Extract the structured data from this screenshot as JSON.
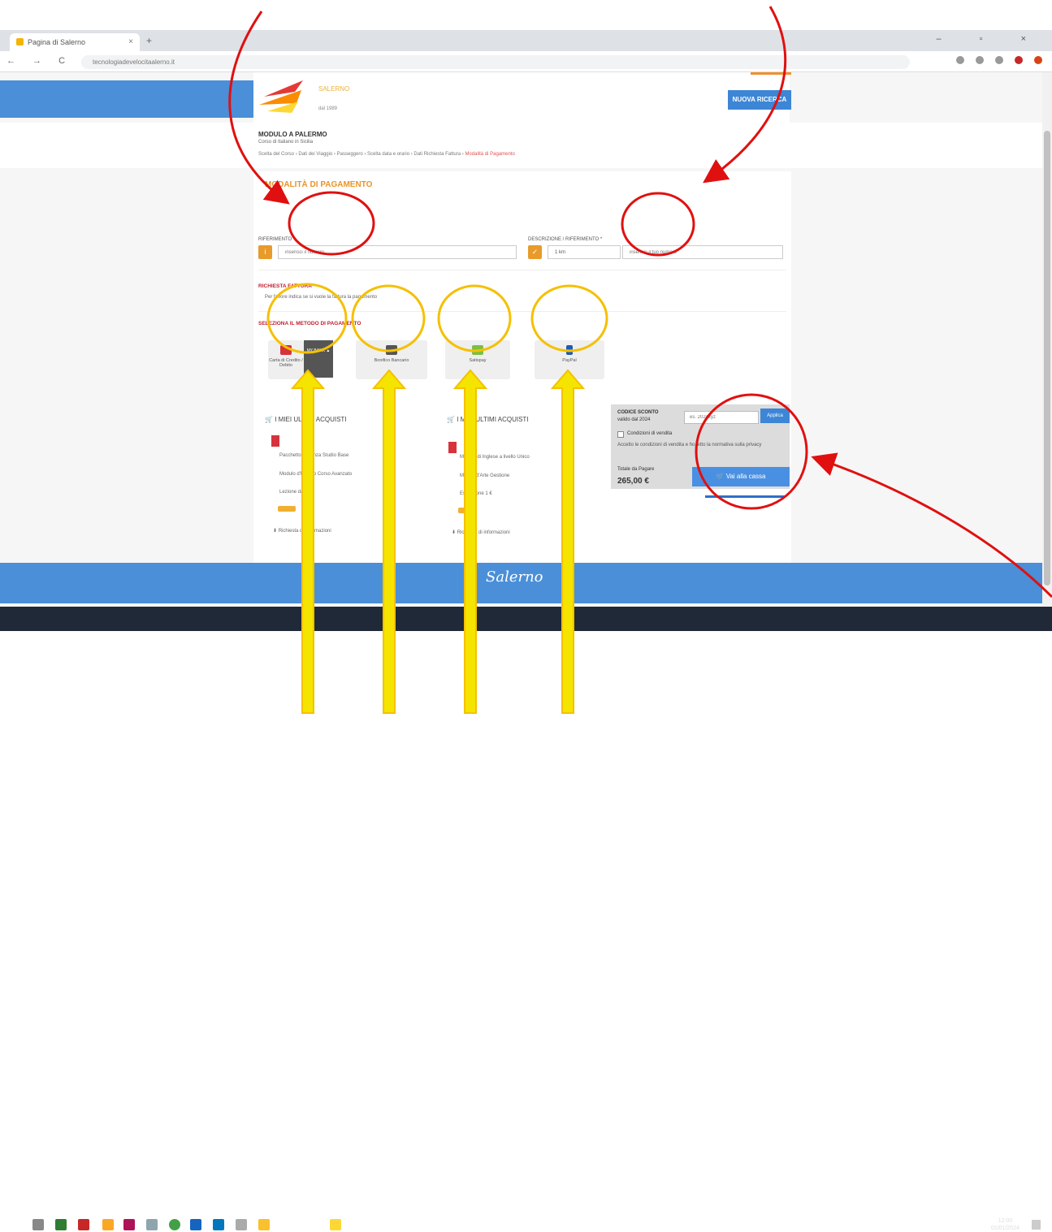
{
  "browser": {
    "tab_title": "Pagina di Salerno",
    "close_glyph": "×",
    "newtab_glyph": "+",
    "window_controls": "–  ▫  ×",
    "nav_glyphs": "← → C ⌂",
    "url": "tecnologiadevelocitaalerno.it"
  },
  "header": {
    "brand": "SALERNO",
    "brand_sub": "dal 1989",
    "cta_label": "NUOVA RICERCA"
  },
  "page": {
    "title": "MODULO A PALERMO",
    "subtitle": "Corso di Italiano in Sicilia",
    "crumbs": [
      "Scelta del Corso",
      "Dati dei Viaggio",
      "Passeggero",
      "Scelta data e orario",
      "Dati Richiesta Fattura",
      "Modalità di Pagamento"
    ],
    "crumb_separator": "›"
  },
  "payment": {
    "heading": "MODALITÀ DI PAGAMENTO",
    "field1_label": "RIFERIMENTO *",
    "field1_icon": "i",
    "field1_placeholder": "inserisci il numero",
    "field2_label": "DESCRIZIONE / RIFERIMENTO *",
    "field2_icon": "✓",
    "field2_value": "1 km",
    "field2_placeholder": "inserisci il tuo numero",
    "invoice_heading": "RICHIESTA FATTURA",
    "invoice_text": "Per favore indica se si vuole la fattura la pagamento",
    "methods_heading": "SELEZIONA IL METODO DI PAGAMENTO",
    "methods": [
      {
        "label": "Carta di Credito / Debito",
        "color": "#d6333d"
      },
      {
        "label": "Bonifico Bancario",
        "color": "#555555"
      },
      {
        "label": "Satispay",
        "color": "#7bc043"
      },
      {
        "label": "PayPal",
        "color": "#1e5bb5"
      }
    ],
    "card_sub": "MY BANK ▲",
    "card_sub_glyph": "▲"
  },
  "orders": [
    {
      "title": "I MIEI ULTIMI ACQUISTI",
      "lines": [
        "Pacchetto Vacanza Studio Base",
        "Modulo d'Italiano Corso Avanzato",
        "Lezione da 3 €",
        "Richiesta di informazioni"
      ]
    },
    {
      "title": "I MIEI ULTIMI ACQUISTI",
      "lines": [
        "Modulo di Inglese a livello Unico",
        "Mostra d'Arte Gestione",
        "Estensione 1 €",
        "Richiesta di informazioni"
      ]
    }
  ],
  "order_icon": "🛒",
  "order_link_glyph": "⬇",
  "summary": {
    "code_label": "CODICE SCONTO",
    "code_sub": "valido dal 2024",
    "code_placeholder": "es. 2024xyz",
    "apply_label": "Applica",
    "terms_label": "Condizioni di vendita",
    "terms_text": "Accetto le condizioni di vendita e ho letto la normativa sulla privacy",
    "total_label": "Totale da Pagare",
    "total_value": "265,00 €",
    "checkout_icon": "🛒",
    "checkout_label": "Vai alla cassa"
  },
  "footer": {
    "logo": "Salerno"
  },
  "taskbar": {
    "time": "12:00",
    "date": "01/01/2024"
  },
  "colors": {
    "accent_blue": "#4a8fd8",
    "accent_orange": "#e8942a",
    "annotation_red": "#e01010",
    "annotation_yellow": "#f5c000"
  }
}
